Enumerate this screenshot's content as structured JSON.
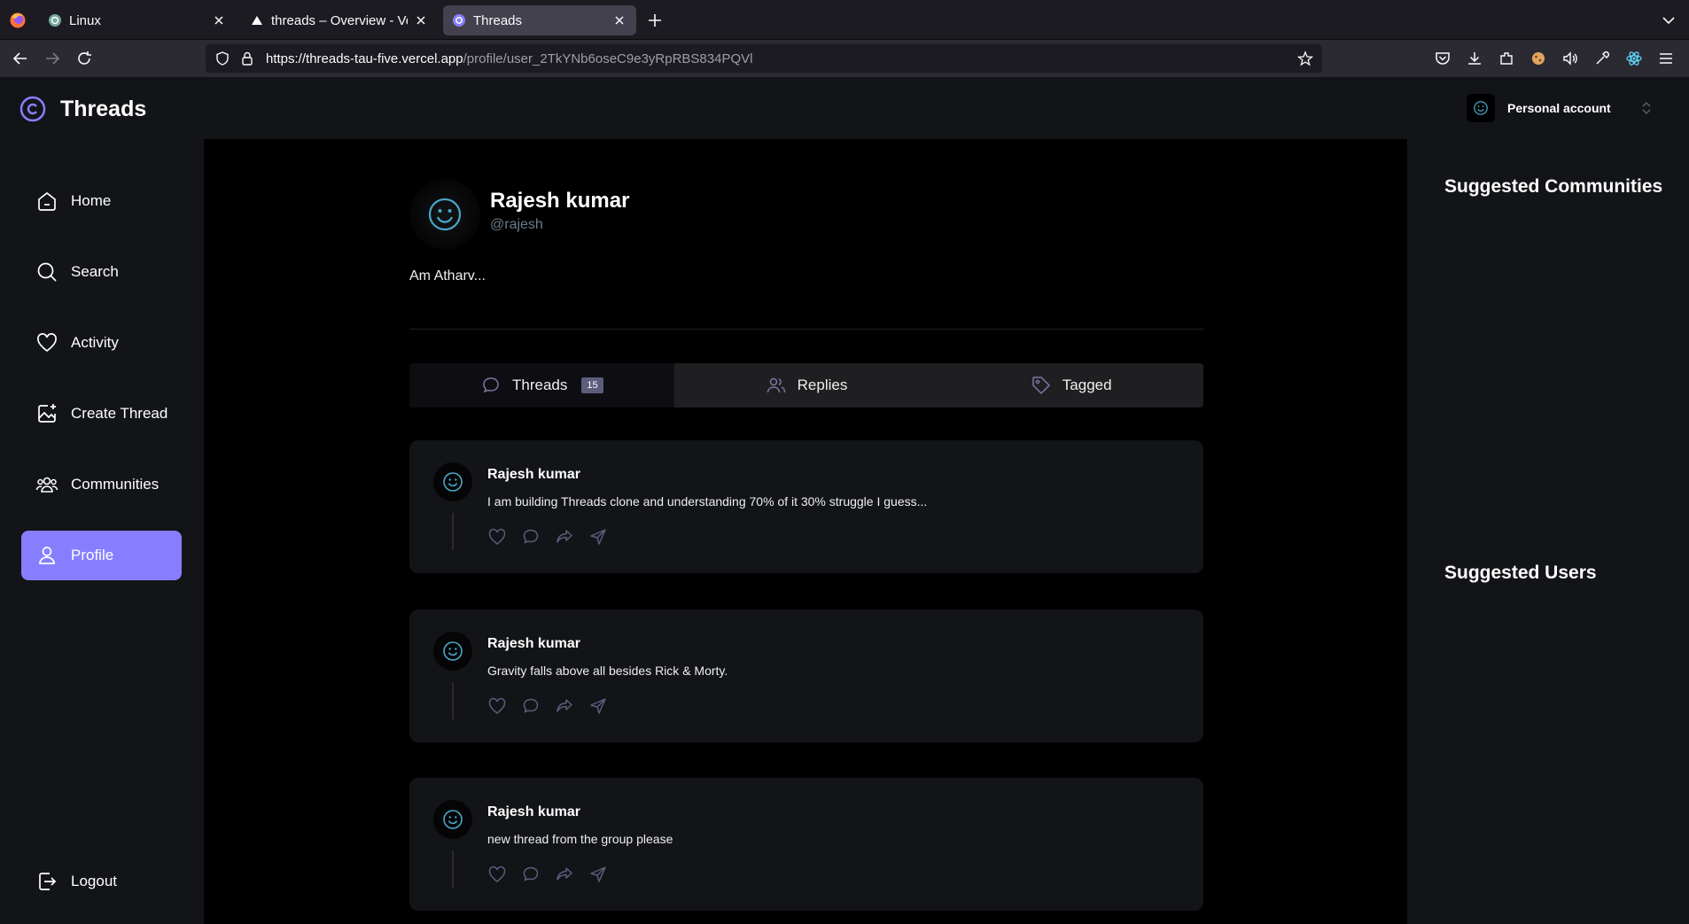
{
  "browser": {
    "tabs": [
      {
        "title": "Linux"
      },
      {
        "title": "threads – Overview - Verc"
      },
      {
        "title": "Threads"
      }
    ],
    "url_host": "https://threads-tau-five.vercel.app",
    "url_path": "/profile/user_2TkYNb6oseC9e3yRpRBS834PQVl"
  },
  "app": {
    "brand": "Threads",
    "account_label": "Personal account"
  },
  "sidebar": {
    "items": [
      {
        "label": "Home",
        "icon": "home-icon"
      },
      {
        "label": "Search",
        "icon": "search-icon"
      },
      {
        "label": "Activity",
        "icon": "heart-icon"
      },
      {
        "label": "Create Thread",
        "icon": "create-thread-icon"
      },
      {
        "label": "Communities",
        "icon": "communities-icon"
      },
      {
        "label": "Profile",
        "icon": "user-icon",
        "active": true
      }
    ],
    "logout_label": "Logout"
  },
  "profile": {
    "name": "Rajesh kumar",
    "handle": "@rajesh",
    "bio": "Am Atharv...",
    "tabs": [
      {
        "label": "Threads",
        "count": "15"
      },
      {
        "label": "Replies"
      },
      {
        "label": "Tagged"
      }
    ]
  },
  "threads": [
    {
      "author": "Rajesh kumar",
      "text": "I am building Threads clone and understanding 70% of it 30% struggle I guess..."
    },
    {
      "author": "Rajesh kumar",
      "text": "Gravity falls above all besides Rick & Morty."
    },
    {
      "author": "Rajesh kumar",
      "text": "new thread from the group please"
    }
  ],
  "rightbar": {
    "communities_title": "Suggested Communities",
    "users_title": "Suggested Users"
  },
  "colors": {
    "accent": "#877eff",
    "panel": "#121417",
    "background": "#000000"
  }
}
